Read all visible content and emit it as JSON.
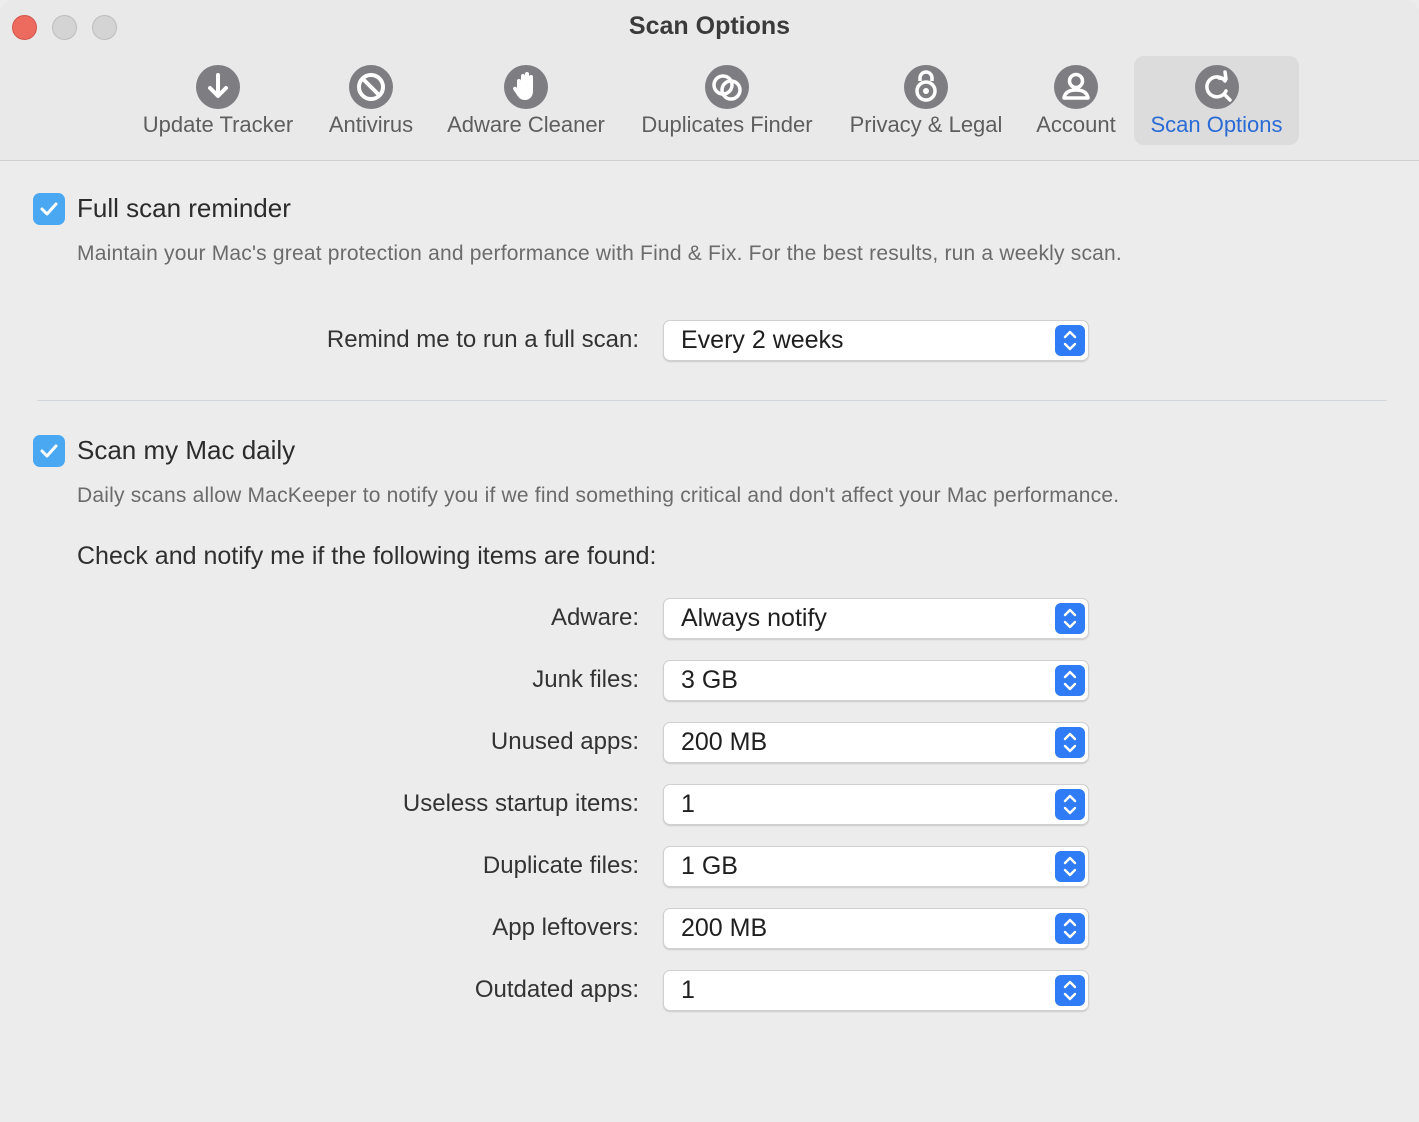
{
  "window": {
    "title": "Scan Options",
    "traffic_lights": [
      "close",
      "minimize",
      "zoom"
    ]
  },
  "toolbar": {
    "tabs": [
      {
        "label": "Update Tracker",
        "icon": "download-arrow-icon",
        "active": false
      },
      {
        "label": "Antivirus",
        "icon": "prohibited-icon",
        "active": false
      },
      {
        "label": "Adware Cleaner",
        "icon": "hand-icon",
        "active": false
      },
      {
        "label": "Duplicates Finder",
        "icon": "duplicate-circles-icon",
        "active": false
      },
      {
        "label": "Privacy & Legal",
        "icon": "lock-icon",
        "active": false
      },
      {
        "label": "Account",
        "icon": "person-icon",
        "active": false
      },
      {
        "label": "Scan Options",
        "icon": "refresh-magnifier-icon",
        "active": true
      }
    ]
  },
  "full_scan": {
    "checked": true,
    "title": "Full scan reminder",
    "description": "Maintain your Mac's great protection and performance with Find & Fix. For the best results, run a weekly scan.",
    "remind_label": "Remind me to run a full scan:",
    "remind_value": "Every 2 weeks"
  },
  "daily_scan": {
    "checked": true,
    "title": "Scan my Mac daily",
    "description": "Daily scans allow MacKeeper to notify you if we find something critical and don't affect your Mac performance.",
    "subheading": "Check and notify me if the following items are found:",
    "items": [
      {
        "label": "Adware:",
        "value": "Always notify"
      },
      {
        "label": "Junk files:",
        "value": "3 GB"
      },
      {
        "label": "Unused apps:",
        "value": "200 MB"
      },
      {
        "label": "Useless startup items:",
        "value": "1"
      },
      {
        "label": "Duplicate files:",
        "value": "1 GB"
      },
      {
        "label": "App leftovers:",
        "value": "200 MB"
      },
      {
        "label": "Outdated apps:",
        "value": "1"
      }
    ]
  },
  "colors": {
    "accent": "#2f7cf6",
    "checkbox": "#4aa8f3",
    "active_tab_label": "#2a6bd6",
    "close_button": "#ec6a5e"
  }
}
